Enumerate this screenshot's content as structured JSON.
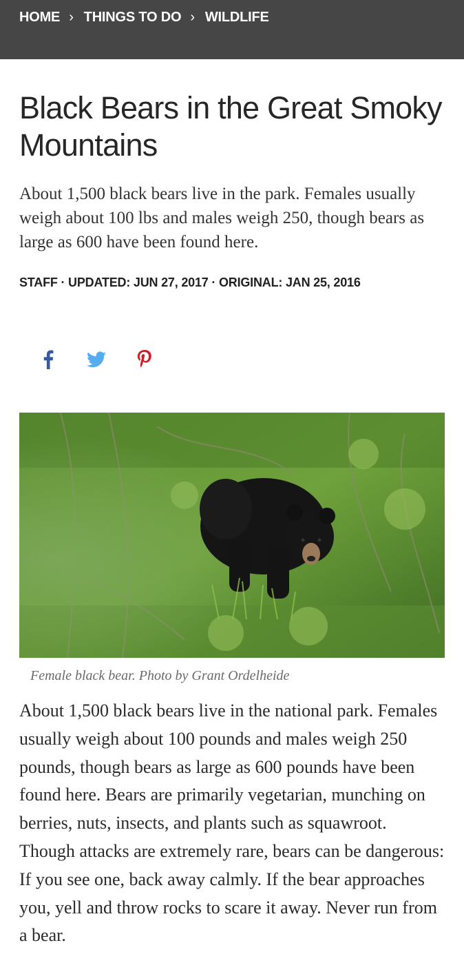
{
  "breadcrumb": {
    "items": [
      "HOME",
      "THINGS TO DO",
      "WILDLIFE"
    ],
    "separator": "›"
  },
  "article": {
    "title": "Black Bears in the Great Smoky Mountains",
    "dek": "About 1,500 black bears live in the park. Females usually weigh about 100 lbs and males weigh 250, though bears as large as 600 have been found here.",
    "byline": "STAFF · UPDATED: JUN 27, 2017 · ORIGINAL: JAN 25, 2016",
    "caption": "Female black bear. Photo by Grant Ordelheide",
    "body": "About 1,500 black bears live in the national park. Females usually weigh about 100 pounds and males weigh 250 pounds, though bears as large as 600 pounds have been found here. Bears are primarily vegetarian, munching on berries, nuts, insects, and plants such as squawroot. Though attacks are extremely rare, bears can be dangerous: If you see one, back away calmly. If the bear approaches you, yell and throw rocks to scare it away. Never run from a bear."
  },
  "share": {
    "icons": [
      "facebook-icon",
      "twitter-icon",
      "pinterest-icon"
    ],
    "colors": {
      "facebook": "#3b5998",
      "twitter": "#55acee",
      "pinterest": "#cb2027"
    }
  },
  "colors": {
    "topbar": "#464646",
    "text": "#262626"
  }
}
